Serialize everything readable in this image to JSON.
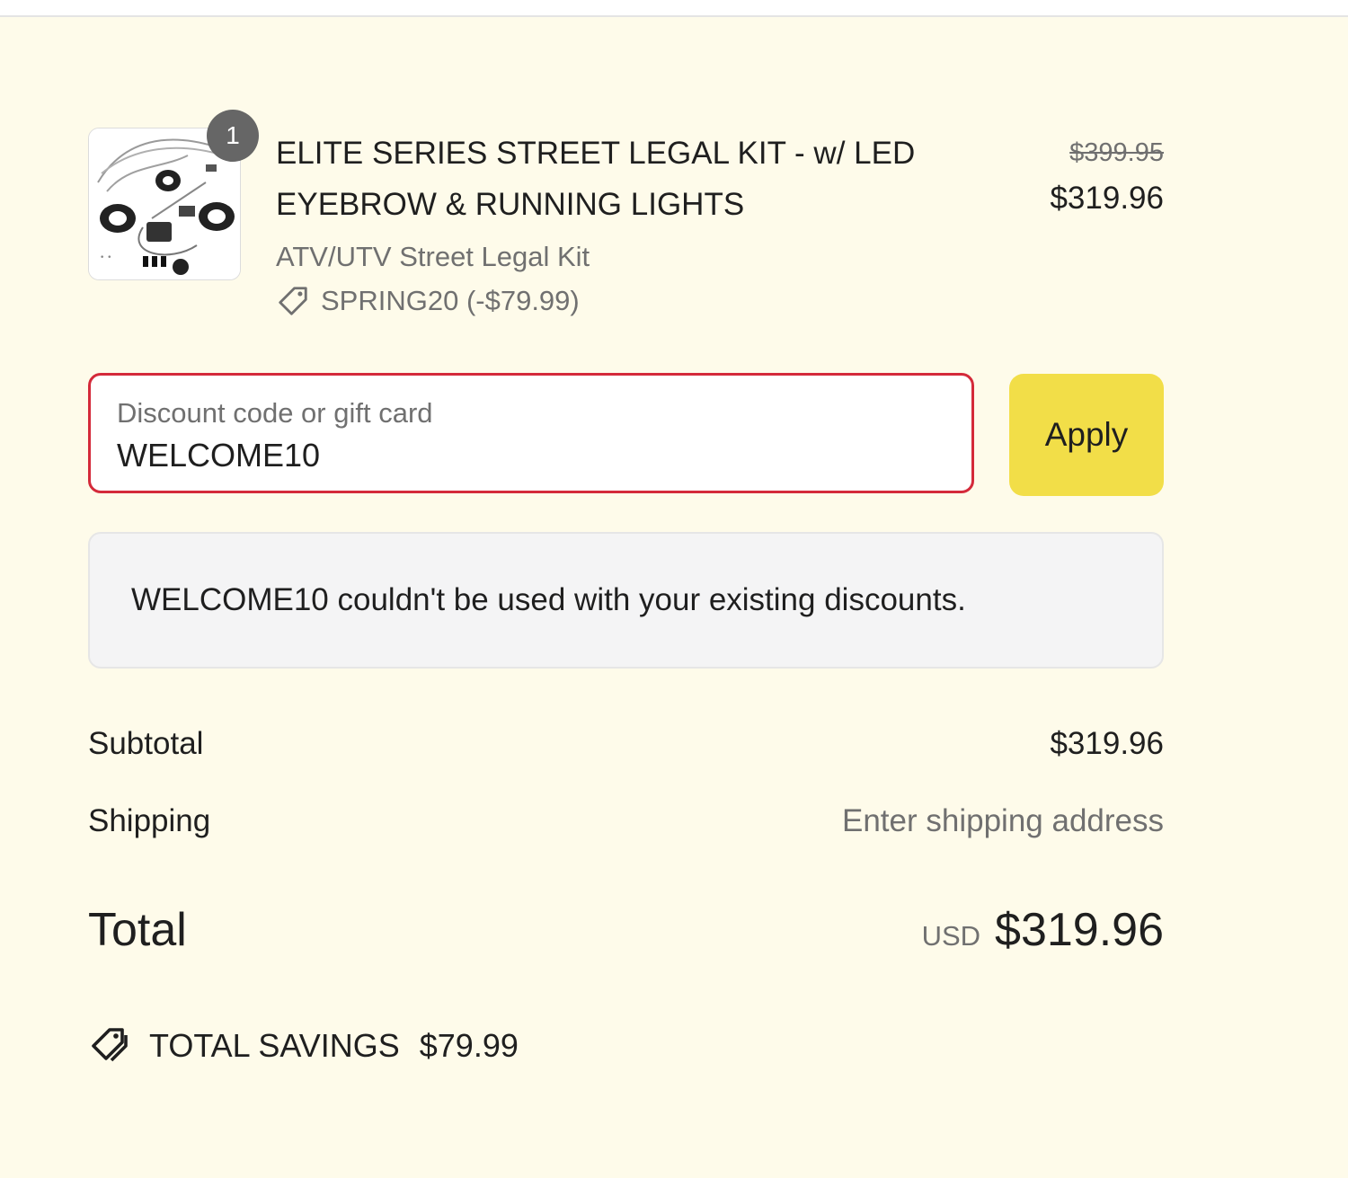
{
  "line_item": {
    "quantity": "1",
    "title": "ELITE SERIES STREET LEGAL KIT - w/ LED EYEBROW & RUNNING LIGHTS",
    "variant": "ATV/UTV Street Legal Kit",
    "applied_discount": "SPRING20 (-$79.99)",
    "compare_price": "$399.95",
    "price": "$319.96",
    "image_icon": "product-kit-image"
  },
  "discount_form": {
    "label": "Discount code or gift card",
    "value": "WELCOME10",
    "apply_label": "Apply"
  },
  "error_message": "WELCOME10 couldn't be used with your existing discounts.",
  "summary": {
    "subtotal_label": "Subtotal",
    "subtotal_value": "$319.96",
    "shipping_label": "Shipping",
    "shipping_value": "Enter shipping address",
    "total_label": "Total",
    "total_currency": "USD",
    "total_value": "$319.96",
    "savings_label": "TOTAL SAVINGS",
    "savings_value": "$79.99"
  },
  "colors": {
    "page_background": "#fefbea",
    "apply_button": "#f2de48",
    "error_border": "#d42a3a",
    "badge": "#666666"
  }
}
